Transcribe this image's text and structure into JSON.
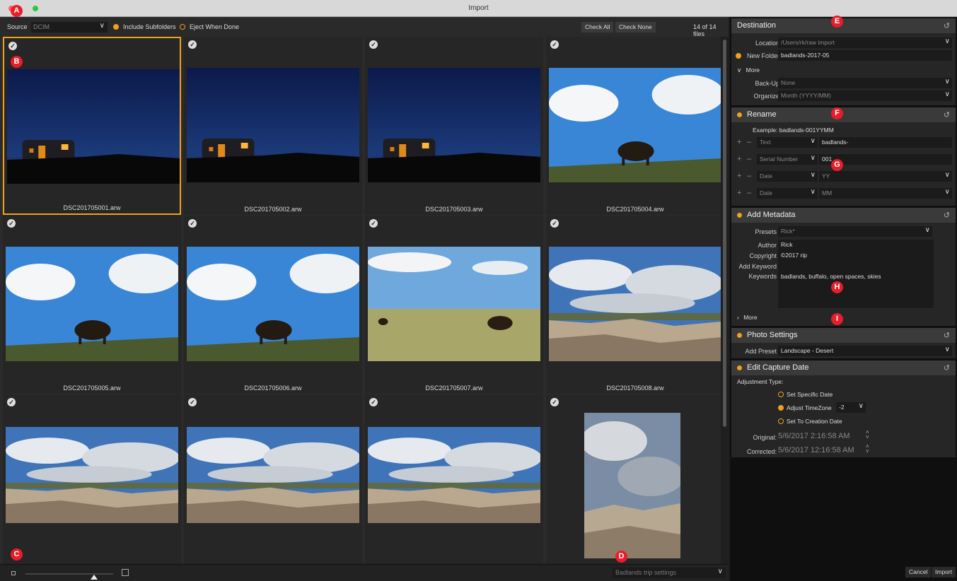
{
  "window": {
    "title": "Import"
  },
  "callouts": [
    "A",
    "B",
    "C",
    "D",
    "E",
    "F",
    "G",
    "H",
    "I"
  ],
  "toolbar": {
    "source_label": "Source",
    "source_value": "DCIM",
    "include_subfolders": "Include Subfolders",
    "eject_when_done": "Eject When Done",
    "check_all": "Check All",
    "check_none": "Check None",
    "file_count": "14 of 14 files"
  },
  "thumbnails": [
    {
      "name": "DSC201705001.arw",
      "scene": "night"
    },
    {
      "name": "DSC201705002.arw",
      "scene": "night"
    },
    {
      "name": "DSC201705003.arw",
      "scene": "night"
    },
    {
      "name": "DSC201705004.arw",
      "scene": "bison"
    },
    {
      "name": "DSC201705005.arw",
      "scene": "bison"
    },
    {
      "name": "DSC201705006.arw",
      "scene": "bison"
    },
    {
      "name": "DSC201705007.arw",
      "scene": "prairie"
    },
    {
      "name": "DSC201705008.arw",
      "scene": "badlands"
    },
    {
      "name": "",
      "scene": "badlands"
    },
    {
      "name": "",
      "scene": "badlands"
    },
    {
      "name": "",
      "scene": "badlands"
    },
    {
      "name": "",
      "scene": "portrait"
    }
  ],
  "bottombar": {
    "preset": "Badlands trip settings",
    "cancel": "Cancel",
    "import": "Import"
  },
  "destination": {
    "title": "Destination",
    "location_label": "Location",
    "location_value": "/Users/rk/raw import",
    "new_folder_label": "New Folder",
    "new_folder_value": "badlands-2017-05",
    "more": "More",
    "backup_label": "Back-Up",
    "backup_value": "None",
    "organize_label": "Organize",
    "organize_value": "Month (YYYY/MM)"
  },
  "rename": {
    "title": "Rename",
    "example": "Example: badlands-001YYMM",
    "rows": [
      {
        "type": "Text",
        "value": "badlands-"
      },
      {
        "type": "Serial Number",
        "value": "001"
      },
      {
        "type": "Date",
        "value": "YY"
      },
      {
        "type": "Date",
        "value": "MM"
      }
    ]
  },
  "metadata": {
    "title": "Add Metadata",
    "presets_label": "Presets",
    "presets_value": "Rick*",
    "author_label": "Author",
    "author_value": "Rick",
    "copyright_label": "Copyright",
    "copyright_value": "©2017 rip",
    "add_keyword_label": "Add Keyword",
    "keywords_label": "Keywords",
    "keywords_value": "badlands, buffalo, open spaces, skies",
    "more": "More"
  },
  "photo_settings": {
    "title": "Photo Settings",
    "add_preset_label": "Add Preset",
    "add_preset_value": "Landscape - Desert"
  },
  "capture_date": {
    "title": "Edit Capture Date",
    "adjust_type_label": "Adjustment Type:",
    "opt_specific": "Set Specific Date",
    "opt_timezone": "Adjust TimeZone",
    "timezone_value": "-2",
    "opt_creation": "Set To Creation Date",
    "original_label": "Original:",
    "original_value": "5/6/2017 2:16:58 AM",
    "corrected_label": "Corrected:",
    "corrected_value": "5/6/2017 12:16:58 AM"
  },
  "colors": {
    "accent": "#f0a020",
    "callout": "#e81d2a"
  }
}
